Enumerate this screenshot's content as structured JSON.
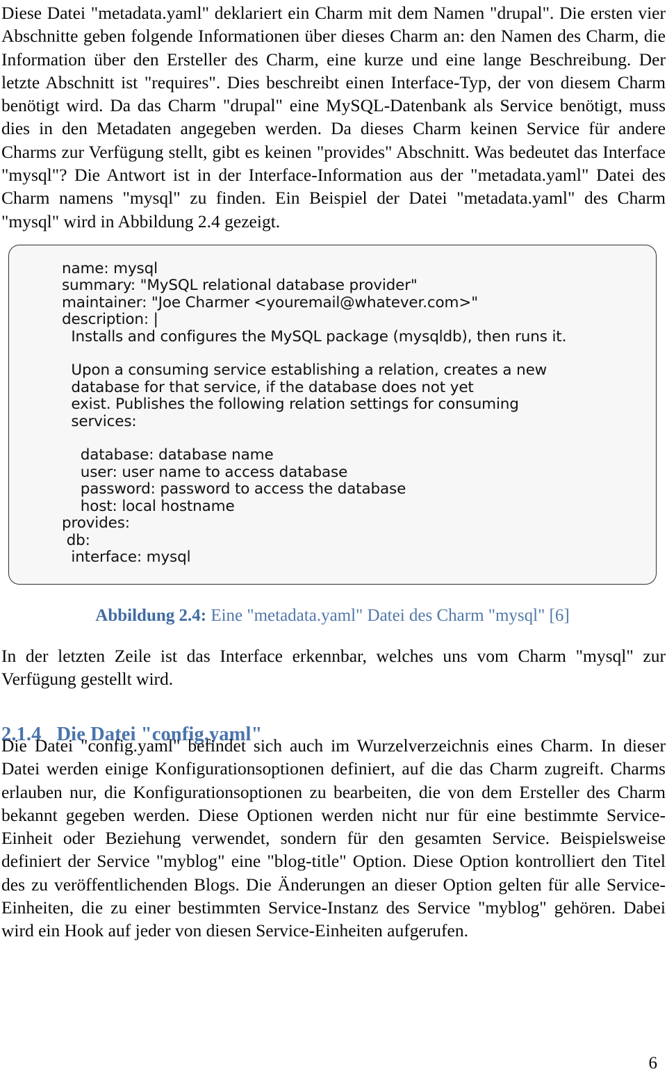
{
  "document": {
    "page_number": "6",
    "accent_heading_color": "#4a74ab",
    "accent_caption_color": "#5278a8",
    "code_box_background": "#f7f7f7",
    "code_box_border": "#2e2e2e",
    "body_text_color": "#0a0a0a"
  },
  "intro_paragraph": "Diese Datei \"metadata.yaml\" deklariert ein Charm mit dem Namen \"drupal\". Die ersten vier Abschnitte geben folgende Informationen über dieses Charm an: den Namen des Charm, die Information über den Ersteller des Charm, eine kurze und eine lange Beschreibung. Der letzte Abschnitt ist \"requires\". Dies beschreibt einen Interface-Typ, der von diesem Charm benötigt wird. Da das Charm \"drupal\" eine MySQL-Datenbank als Service benötigt, muss dies in den Metadaten angegeben werden. Da dieses Charm keinen Service für andere Charms zur Verfügung stellt, gibt es keinen \"provides\" Abschnitt. Was bedeutet das Interface \"mysql\"? Die Antwort ist in der Interface-Information aus der \"metadata.yaml\" Datei des Charm namens \"mysql\" zu finden. Ein Beispiel der Datei \"metadata.yaml\" des Charm \"mysql\" wird in Abbildung 2.4 gezeigt.",
  "figure": {
    "code_lines": [
      "name: mysql",
      "summary: \"MySQL relational database provider\"",
      "maintainer: \"Joe Charmer <youremail@whatever.com>\"",
      "description: |",
      "  Installs and configures the MySQL package (mysqldb), then runs it.",
      "",
      "  Upon a consuming service establishing a relation, creates a new",
      "  database for that service, if the database does not yet",
      "  exist. Publishes the following relation settings for consuming",
      "  services:",
      "",
      "    database: database name",
      "    user: user name to access database",
      "    password: password to access the database",
      "    host: local hostname",
      "provides:",
      " db:",
      "  interface: mysql"
    ],
    "caption_label": "Abbildung 2.4:",
    "caption_text": " Eine \"metadata.yaml\" Datei des Charm \"mysql\" [6]"
  },
  "post_figure_paragraph": "In der letzten Zeile ist das Interface erkennbar, welches uns vom Charm \"mysql\" zur Verfügung gestellt wird.",
  "section": {
    "number": "2.1.4",
    "title": "Die Datei \"config.yaml\""
  },
  "config_paragraph": "Die Datei \"config.yaml\" befindet sich auch im Wurzelverzeichnis eines Charm. In dieser Datei werden einige Konfigurationsoptionen definiert, auf die das Charm zugreift. Charms erlauben nur, die Konfigurationsoptionen zu bearbeiten, die von dem Ersteller des Charm bekannt gegeben werden. Diese Optionen werden nicht nur für eine bestimmte Service-Einheit oder Beziehung verwendet, sondern für den gesamten Service. Beispielsweise definiert der Service \"myblog\" eine \"blog-title\" Option. Diese Option kontrolliert den Titel des zu veröffentlichenden Blogs. Die Änderungen an dieser Option gelten für alle Service-Einheiten, die zu einer bestimmten Service-Instanz des Service \"myblog\" gehören. Dabei wird ein Hook auf jeder von diesen Service-Einheiten aufgerufen."
}
